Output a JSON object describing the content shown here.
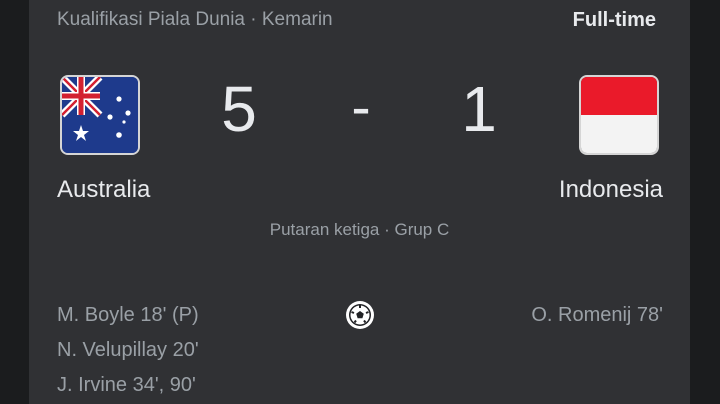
{
  "header": {
    "competition": "Kualifikasi Piala Dunia · Kemarin",
    "status": "Full-time"
  },
  "match": {
    "home": {
      "name": "Australia",
      "score": "5",
      "flag": "australia-flag-icon"
    },
    "separator": "-",
    "away": {
      "name": "Indonesia",
      "score": "1",
      "flag": "indonesia-flag-icon"
    },
    "round": "Putaran ketiga · Grup C"
  },
  "scorers": {
    "home": [
      "M. Boyle 18' (P)",
      "N. Velupillay 20'",
      "J. Irvine 34', 90'"
    ],
    "away": [
      "O. Romenij 78'"
    ],
    "icon": "soccer-ball-icon"
  },
  "colors": {
    "card_bg": "#303134",
    "page_bg": "#1b1c1e",
    "primary_text": "#e8eaed",
    "secondary_text": "#9aa0a6"
  }
}
